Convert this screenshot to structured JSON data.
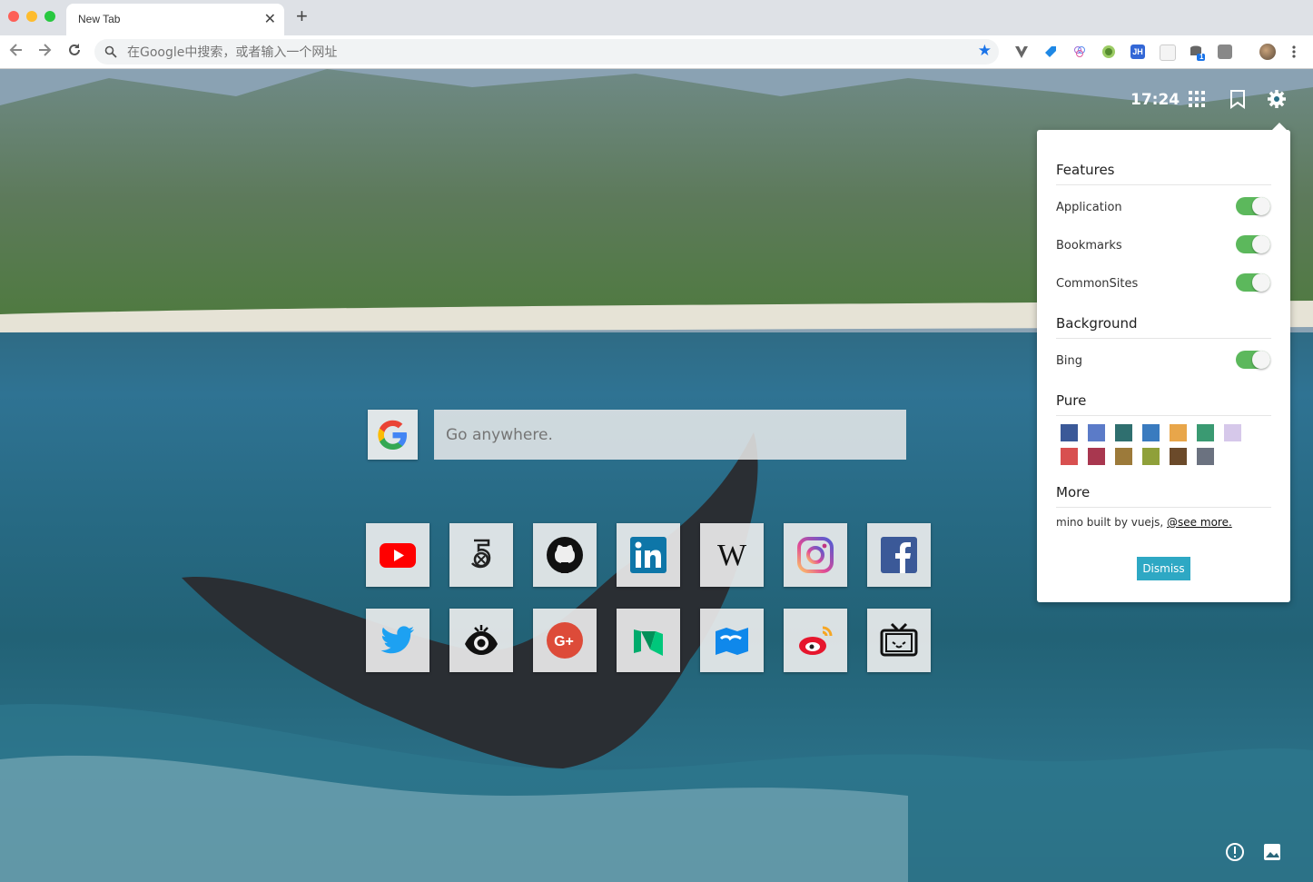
{
  "browser": {
    "tab_title": "New Tab",
    "close_symbol": "✕",
    "new_tab_symbol": "+",
    "omnibox_placeholder": "在Google中搜索，或者输入一个网址",
    "extensions": [
      "vue-devtools-icon",
      "tag-icon",
      "flower-icon",
      "green-dot-icon",
      "jh-icon",
      "blank-icon",
      "db-icon",
      "rp-icon",
      "avatar-icon",
      "menu-icon"
    ],
    "extension_badge": "1",
    "ext_jh_label": "JH"
  },
  "header": {
    "time": "17:24"
  },
  "search": {
    "placeholder": "Go anywhere."
  },
  "sites": [
    {
      "name": "youtube",
      "color": "#ff0000"
    },
    {
      "name": "500px",
      "color": "#222222"
    },
    {
      "name": "github",
      "color": "#111111"
    },
    {
      "name": "linkedin",
      "color": "#0e76a8"
    },
    {
      "name": "wikipedia",
      "color": "#111111"
    },
    {
      "name": "instagram",
      "color": "#c13584"
    },
    {
      "name": "facebook",
      "color": "#3b5998"
    },
    {
      "name": "twitter",
      "color": "#1da1f2"
    },
    {
      "name": "douban",
      "color": "#111111"
    },
    {
      "name": "google-plus",
      "color": "#dd4b39"
    },
    {
      "name": "medium",
      "color": "#00ab6c"
    },
    {
      "name": "zhihu",
      "color": "#0f88eb"
    },
    {
      "name": "weibo",
      "color": "#e6162d"
    },
    {
      "name": "bilibili",
      "color": "#111111"
    }
  ],
  "settings": {
    "features_heading": "Features",
    "features": [
      {
        "label": "Application",
        "on": true
      },
      {
        "label": "Bookmarks",
        "on": true
      },
      {
        "label": "CommonSites",
        "on": true
      }
    ],
    "background_heading": "Background",
    "bing_label": "Bing",
    "bing_on": true,
    "pure_heading": "Pure",
    "pure_colors": [
      "#3b5998",
      "#5b7bc8",
      "#2f6f6f",
      "#3a7bbf",
      "#e8a64a",
      "#3a9a72",
      "#d6c8ea",
      "#d85050",
      "#a8374f",
      "#9c7a3a",
      "#8fa03a",
      "#6b4a2a",
      "#6b7280"
    ],
    "more_heading": "More",
    "more_text": "mino built by vuejs,",
    "more_link": "@see more.",
    "dismiss_label": "Dismiss"
  }
}
